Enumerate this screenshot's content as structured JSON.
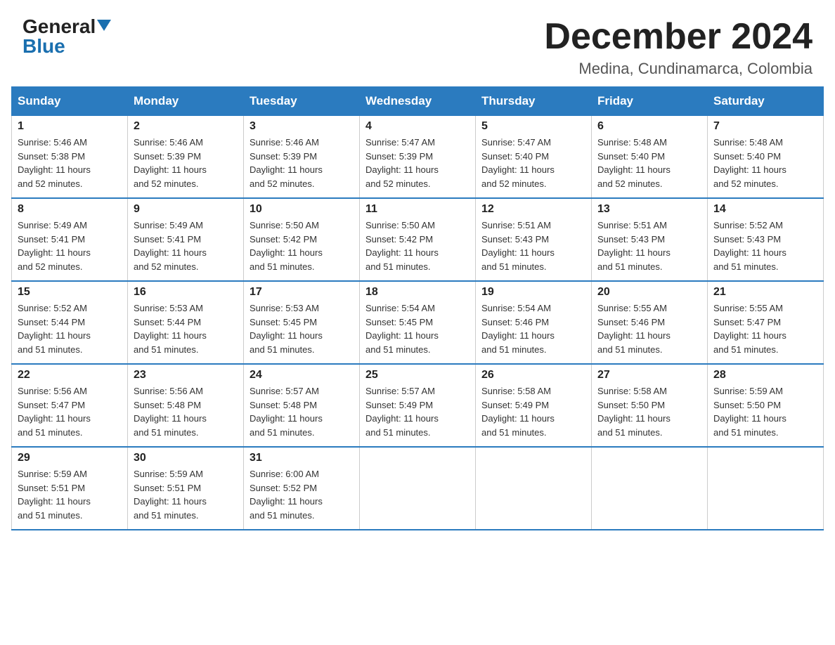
{
  "logo": {
    "general": "General",
    "blue": "Blue"
  },
  "title": "December 2024",
  "location": "Medina, Cundinamarca, Colombia",
  "headers": [
    "Sunday",
    "Monday",
    "Tuesday",
    "Wednesday",
    "Thursday",
    "Friday",
    "Saturday"
  ],
  "weeks": [
    [
      {
        "day": "1",
        "sunrise": "5:46 AM",
        "sunset": "5:38 PM",
        "daylight": "11 hours and 52 minutes."
      },
      {
        "day": "2",
        "sunrise": "5:46 AM",
        "sunset": "5:39 PM",
        "daylight": "11 hours and 52 minutes."
      },
      {
        "day": "3",
        "sunrise": "5:46 AM",
        "sunset": "5:39 PM",
        "daylight": "11 hours and 52 minutes."
      },
      {
        "day": "4",
        "sunrise": "5:47 AM",
        "sunset": "5:39 PM",
        "daylight": "11 hours and 52 minutes."
      },
      {
        "day": "5",
        "sunrise": "5:47 AM",
        "sunset": "5:40 PM",
        "daylight": "11 hours and 52 minutes."
      },
      {
        "day": "6",
        "sunrise": "5:48 AM",
        "sunset": "5:40 PM",
        "daylight": "11 hours and 52 minutes."
      },
      {
        "day": "7",
        "sunrise": "5:48 AM",
        "sunset": "5:40 PM",
        "daylight": "11 hours and 52 minutes."
      }
    ],
    [
      {
        "day": "8",
        "sunrise": "5:49 AM",
        "sunset": "5:41 PM",
        "daylight": "11 hours and 52 minutes."
      },
      {
        "day": "9",
        "sunrise": "5:49 AM",
        "sunset": "5:41 PM",
        "daylight": "11 hours and 52 minutes."
      },
      {
        "day": "10",
        "sunrise": "5:50 AM",
        "sunset": "5:42 PM",
        "daylight": "11 hours and 51 minutes."
      },
      {
        "day": "11",
        "sunrise": "5:50 AM",
        "sunset": "5:42 PM",
        "daylight": "11 hours and 51 minutes."
      },
      {
        "day": "12",
        "sunrise": "5:51 AM",
        "sunset": "5:43 PM",
        "daylight": "11 hours and 51 minutes."
      },
      {
        "day": "13",
        "sunrise": "5:51 AM",
        "sunset": "5:43 PM",
        "daylight": "11 hours and 51 minutes."
      },
      {
        "day": "14",
        "sunrise": "5:52 AM",
        "sunset": "5:43 PM",
        "daylight": "11 hours and 51 minutes."
      }
    ],
    [
      {
        "day": "15",
        "sunrise": "5:52 AM",
        "sunset": "5:44 PM",
        "daylight": "11 hours and 51 minutes."
      },
      {
        "day": "16",
        "sunrise": "5:53 AM",
        "sunset": "5:44 PM",
        "daylight": "11 hours and 51 minutes."
      },
      {
        "day": "17",
        "sunrise": "5:53 AM",
        "sunset": "5:45 PM",
        "daylight": "11 hours and 51 minutes."
      },
      {
        "day": "18",
        "sunrise": "5:54 AM",
        "sunset": "5:45 PM",
        "daylight": "11 hours and 51 minutes."
      },
      {
        "day": "19",
        "sunrise": "5:54 AM",
        "sunset": "5:46 PM",
        "daylight": "11 hours and 51 minutes."
      },
      {
        "day": "20",
        "sunrise": "5:55 AM",
        "sunset": "5:46 PM",
        "daylight": "11 hours and 51 minutes."
      },
      {
        "day": "21",
        "sunrise": "5:55 AM",
        "sunset": "5:47 PM",
        "daylight": "11 hours and 51 minutes."
      }
    ],
    [
      {
        "day": "22",
        "sunrise": "5:56 AM",
        "sunset": "5:47 PM",
        "daylight": "11 hours and 51 minutes."
      },
      {
        "day": "23",
        "sunrise": "5:56 AM",
        "sunset": "5:48 PM",
        "daylight": "11 hours and 51 minutes."
      },
      {
        "day": "24",
        "sunrise": "5:57 AM",
        "sunset": "5:48 PM",
        "daylight": "11 hours and 51 minutes."
      },
      {
        "day": "25",
        "sunrise": "5:57 AM",
        "sunset": "5:49 PM",
        "daylight": "11 hours and 51 minutes."
      },
      {
        "day": "26",
        "sunrise": "5:58 AM",
        "sunset": "5:49 PM",
        "daylight": "11 hours and 51 minutes."
      },
      {
        "day": "27",
        "sunrise": "5:58 AM",
        "sunset": "5:50 PM",
        "daylight": "11 hours and 51 minutes."
      },
      {
        "day": "28",
        "sunrise": "5:59 AM",
        "sunset": "5:50 PM",
        "daylight": "11 hours and 51 minutes."
      }
    ],
    [
      {
        "day": "29",
        "sunrise": "5:59 AM",
        "sunset": "5:51 PM",
        "daylight": "11 hours and 51 minutes."
      },
      {
        "day": "30",
        "sunrise": "5:59 AM",
        "sunset": "5:51 PM",
        "daylight": "11 hours and 51 minutes."
      },
      {
        "day": "31",
        "sunrise": "6:00 AM",
        "sunset": "5:52 PM",
        "daylight": "11 hours and 51 minutes."
      },
      null,
      null,
      null,
      null
    ]
  ],
  "labels": {
    "sunrise": "Sunrise:",
    "sunset": "Sunset:",
    "daylight": "Daylight:"
  }
}
